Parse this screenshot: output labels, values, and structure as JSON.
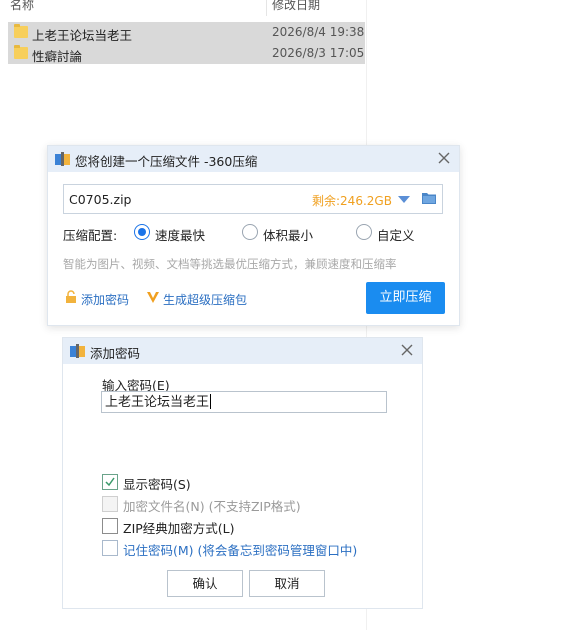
{
  "explorer": {
    "columns": {
      "name": "名称",
      "modified": "修改日期"
    },
    "files": [
      {
        "name": "上老王论坛当老王",
        "date": "2026/8/4 19:38"
      },
      {
        "name": "性癖討論",
        "date": "2026/8/3 17:05"
      }
    ]
  },
  "compress_dialog": {
    "title": "您将创建一个压缩文件 -360压缩",
    "filename": "C0705.zip",
    "remaining": "剩余:246.2GB",
    "config_label": "压缩配置:",
    "options": [
      "速度最快",
      "体积最小",
      "自定义"
    ],
    "selected_option": "速度最快",
    "hint": "智能为图片、视频、文档等挑选最优压缩方式，兼顾速度和压缩率",
    "add_password": "添加密码",
    "super_package": "生成超级压缩包",
    "compress_button": "立即压缩",
    "accent_color": "#1a8cf0",
    "remaining_color": "#f0a020"
  },
  "password_dialog": {
    "title": "添加密码",
    "input_label": "输入密码(E)",
    "password_value": "上老王论坛当老王",
    "show_password": {
      "label": "显示密码(S)",
      "checked": true
    },
    "encrypt_filename": {
      "label": "加密文件名(N) (不支持ZIP格式)",
      "checked": false,
      "disabled": true
    },
    "zip_classic": {
      "label": "ZIP经典加密方式(L)",
      "checked": false
    },
    "remember_password": {
      "label": "记住密码(M) (将会备忘到密码管理窗口中)",
      "checked": false
    },
    "ok_button": "确认",
    "cancel_button": "取消"
  }
}
